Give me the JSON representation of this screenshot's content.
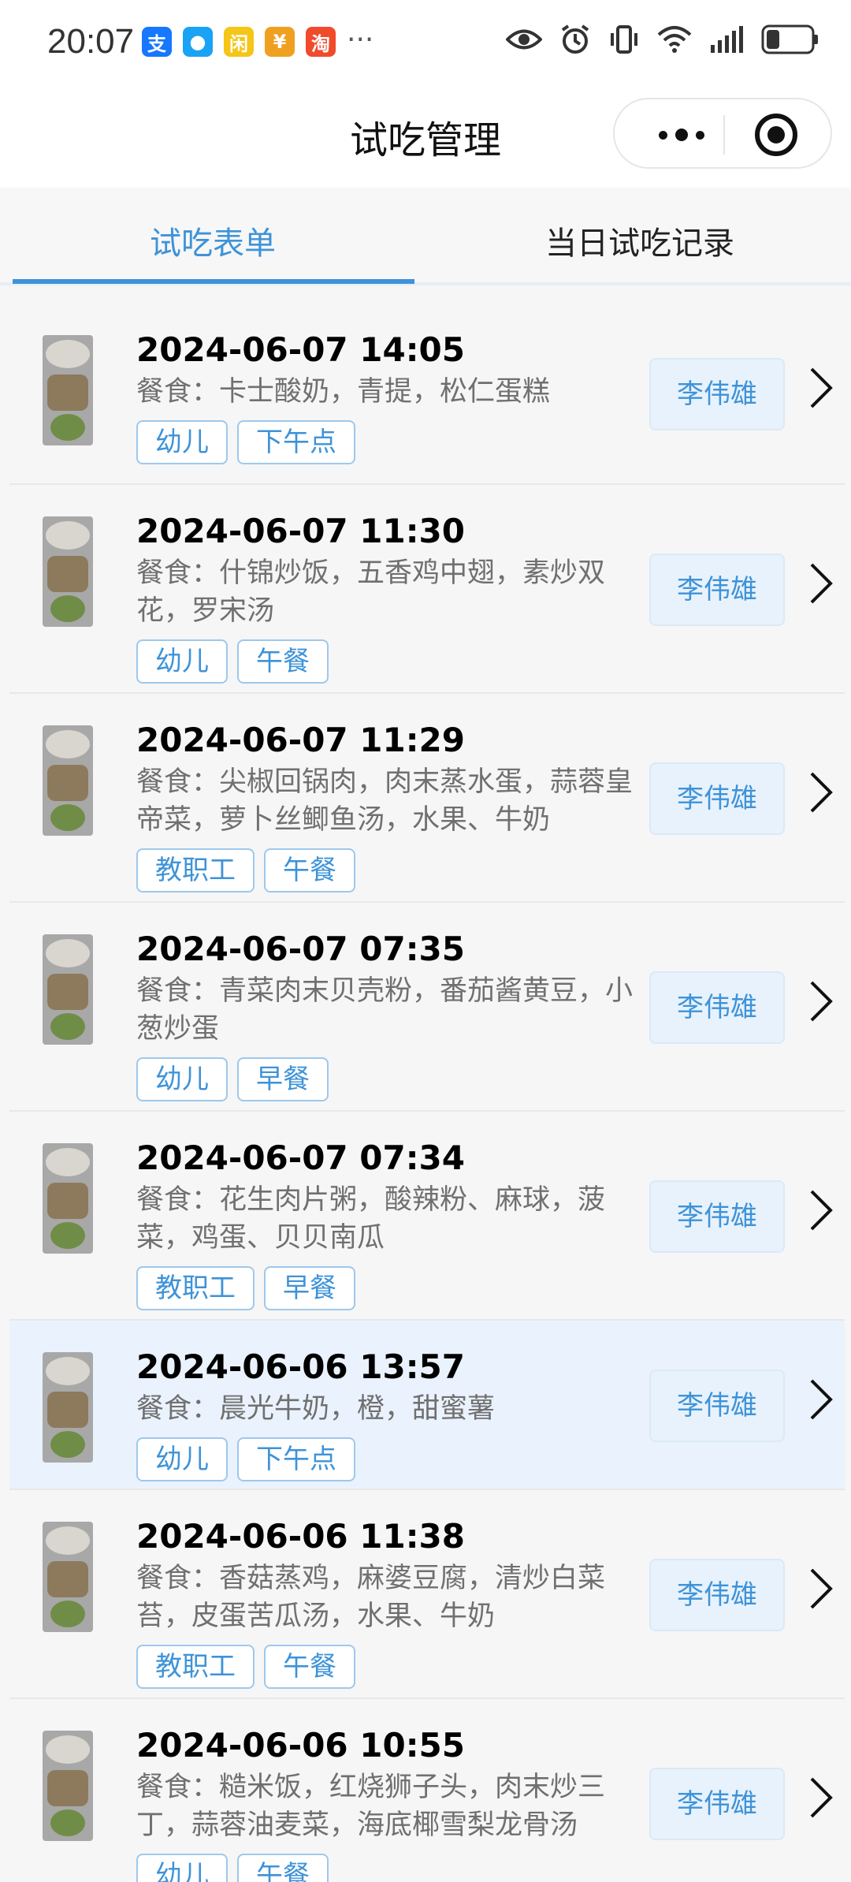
{
  "status_bar": {
    "time": "20:07",
    "app_badges": [
      {
        "icon": "alipay-icon",
        "glyph": "支",
        "color": "#1677ff"
      },
      {
        "icon": "message-icon",
        "glyph": "●",
        "color": "#1aa3f5"
      },
      {
        "icon": "news-icon",
        "glyph": "闲",
        "color": "#f5c518"
      },
      {
        "icon": "redpacket-icon",
        "glyph": "¥",
        "color": "#f0a020"
      },
      {
        "icon": "taobao-icon",
        "glyph": "淘",
        "color": "#f04b2b"
      }
    ],
    "more_notifications": "···",
    "battery_level": 0.3
  },
  "nav": {
    "title": "试吃管理"
  },
  "tabs": {
    "items": [
      "试吃表单",
      "当日试吃记录"
    ],
    "active_index": 0,
    "accent_color": "#3e93d8"
  },
  "records": [
    {
      "time": "2024-06-07 14:05",
      "meal": "餐食：卡士酸奶，青提，松仁蛋糕",
      "tags": [
        "幼儿",
        "下午点"
      ],
      "person": "李伟雄",
      "highlighted": false
    },
    {
      "time": "2024-06-07 11:30",
      "meal": "餐食：什锦炒饭，五香鸡中翅，素炒双花，罗宋汤",
      "tags": [
        "幼儿",
        "午餐"
      ],
      "person": "李伟雄",
      "highlighted": false
    },
    {
      "time": "2024-06-07 11:29",
      "meal": "餐食：尖椒回锅肉，肉末蒸水蛋，蒜蓉皇帝菜，萝卜丝鲫鱼汤，水果、牛奶",
      "tags": [
        "教职工",
        "午餐"
      ],
      "person": "李伟雄",
      "highlighted": false
    },
    {
      "time": "2024-06-07 07:35",
      "meal": "餐食：青菜肉末贝壳粉，番茄酱黄豆，小葱炒蛋",
      "tags": [
        "幼儿",
        "早餐"
      ],
      "person": "李伟雄",
      "highlighted": false
    },
    {
      "time": "2024-06-07 07:34",
      "meal": "餐食：花生肉片粥，酸辣粉、麻球，菠菜，鸡蛋、贝贝南瓜",
      "tags": [
        "教职工",
        "早餐"
      ],
      "person": "李伟雄",
      "highlighted": false
    },
    {
      "time": "2024-06-06 13:57",
      "meal": "餐食：晨光牛奶，橙，甜蜜薯",
      "tags": [
        "幼儿",
        "下午点"
      ],
      "person": "李伟雄",
      "highlighted": true
    },
    {
      "time": "2024-06-06 11:38",
      "meal": "餐食：香菇蒸鸡，麻婆豆腐，清炒白菜苔，皮蛋苦瓜汤，水果、牛奶",
      "tags": [
        "教职工",
        "午餐"
      ],
      "person": "李伟雄",
      "highlighted": false
    },
    {
      "time": "2024-06-06 10:55",
      "meal": "餐食：糙米饭，红烧狮子头，肉末炒三丁，蒜蓉油麦菜，海底椰雪梨龙骨汤",
      "tags": [
        "幼儿",
        "午餐"
      ],
      "person": "李伟雄",
      "highlighted": false
    }
  ]
}
